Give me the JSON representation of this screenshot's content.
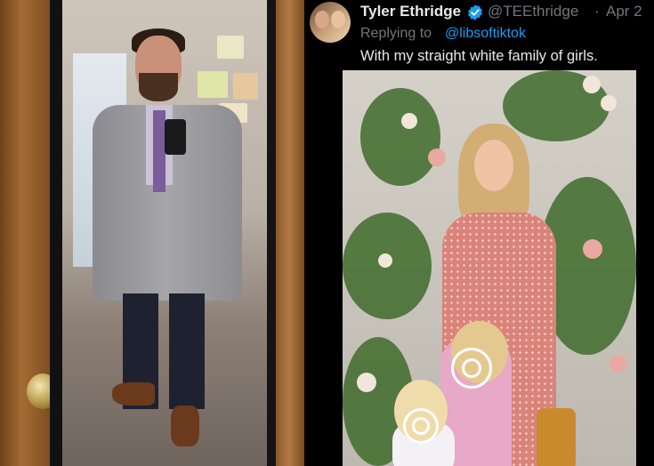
{
  "tweet": {
    "display_name": "Tyler Ethridge",
    "handle": "@TEEthridge",
    "separator": "·",
    "date": "Apr 2",
    "replying_prefix": "Replying to",
    "replying_handle": "@libsoftiktok",
    "text": "With my straight white family of girls.",
    "verified": true
  },
  "colors": {
    "background": "#000000",
    "text_primary": "#e7e9ea",
    "text_secondary": "#71767b",
    "link": "#1d9bf0",
    "verified_badge": "#1d9bf0"
  },
  "icons": {
    "verified": "verified-badge-icon"
  }
}
